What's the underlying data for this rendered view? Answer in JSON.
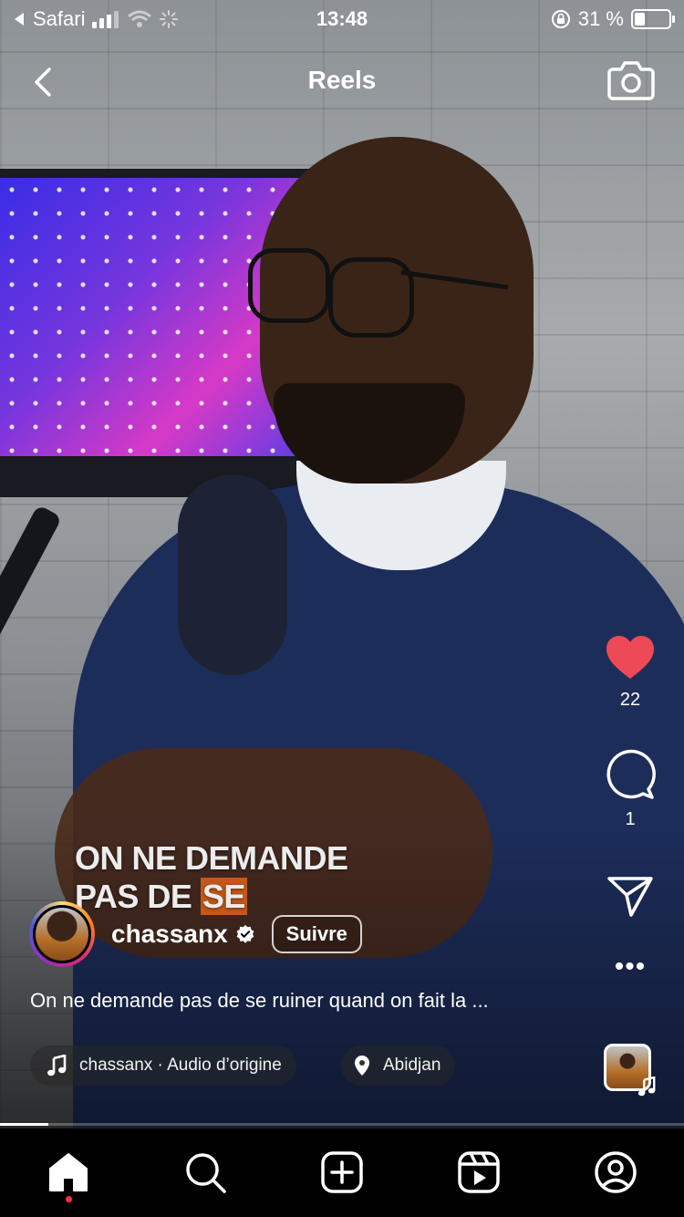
{
  "status_bar": {
    "back_app": "Safari",
    "time": "13:48",
    "battery_percent": "31 %",
    "battery_level": 0.31
  },
  "header": {
    "title": "Reels",
    "back_icon": "chevron-left-icon",
    "camera_icon": "camera-icon"
  },
  "video_overlay": {
    "line1": "ON NE DEMANDE",
    "line2_plain": "PAS DE ",
    "line2_highlight": "SE"
  },
  "actions": {
    "likes": "22",
    "comments": "1",
    "like_color": "#ED4956"
  },
  "author": {
    "username": "chassanx",
    "follow_label": "Suivre"
  },
  "caption": "On ne demande pas de se ruiner quand on fait la ...",
  "audio": {
    "label": "chassanx · Audio d’origine"
  },
  "location": {
    "label": "Abidjan"
  },
  "playback": {
    "progress": 0.07
  },
  "bottom_nav": {
    "items": [
      "home-icon",
      "search-icon",
      "create-icon",
      "reels-icon",
      "profile-icon"
    ],
    "active": "home-icon"
  }
}
